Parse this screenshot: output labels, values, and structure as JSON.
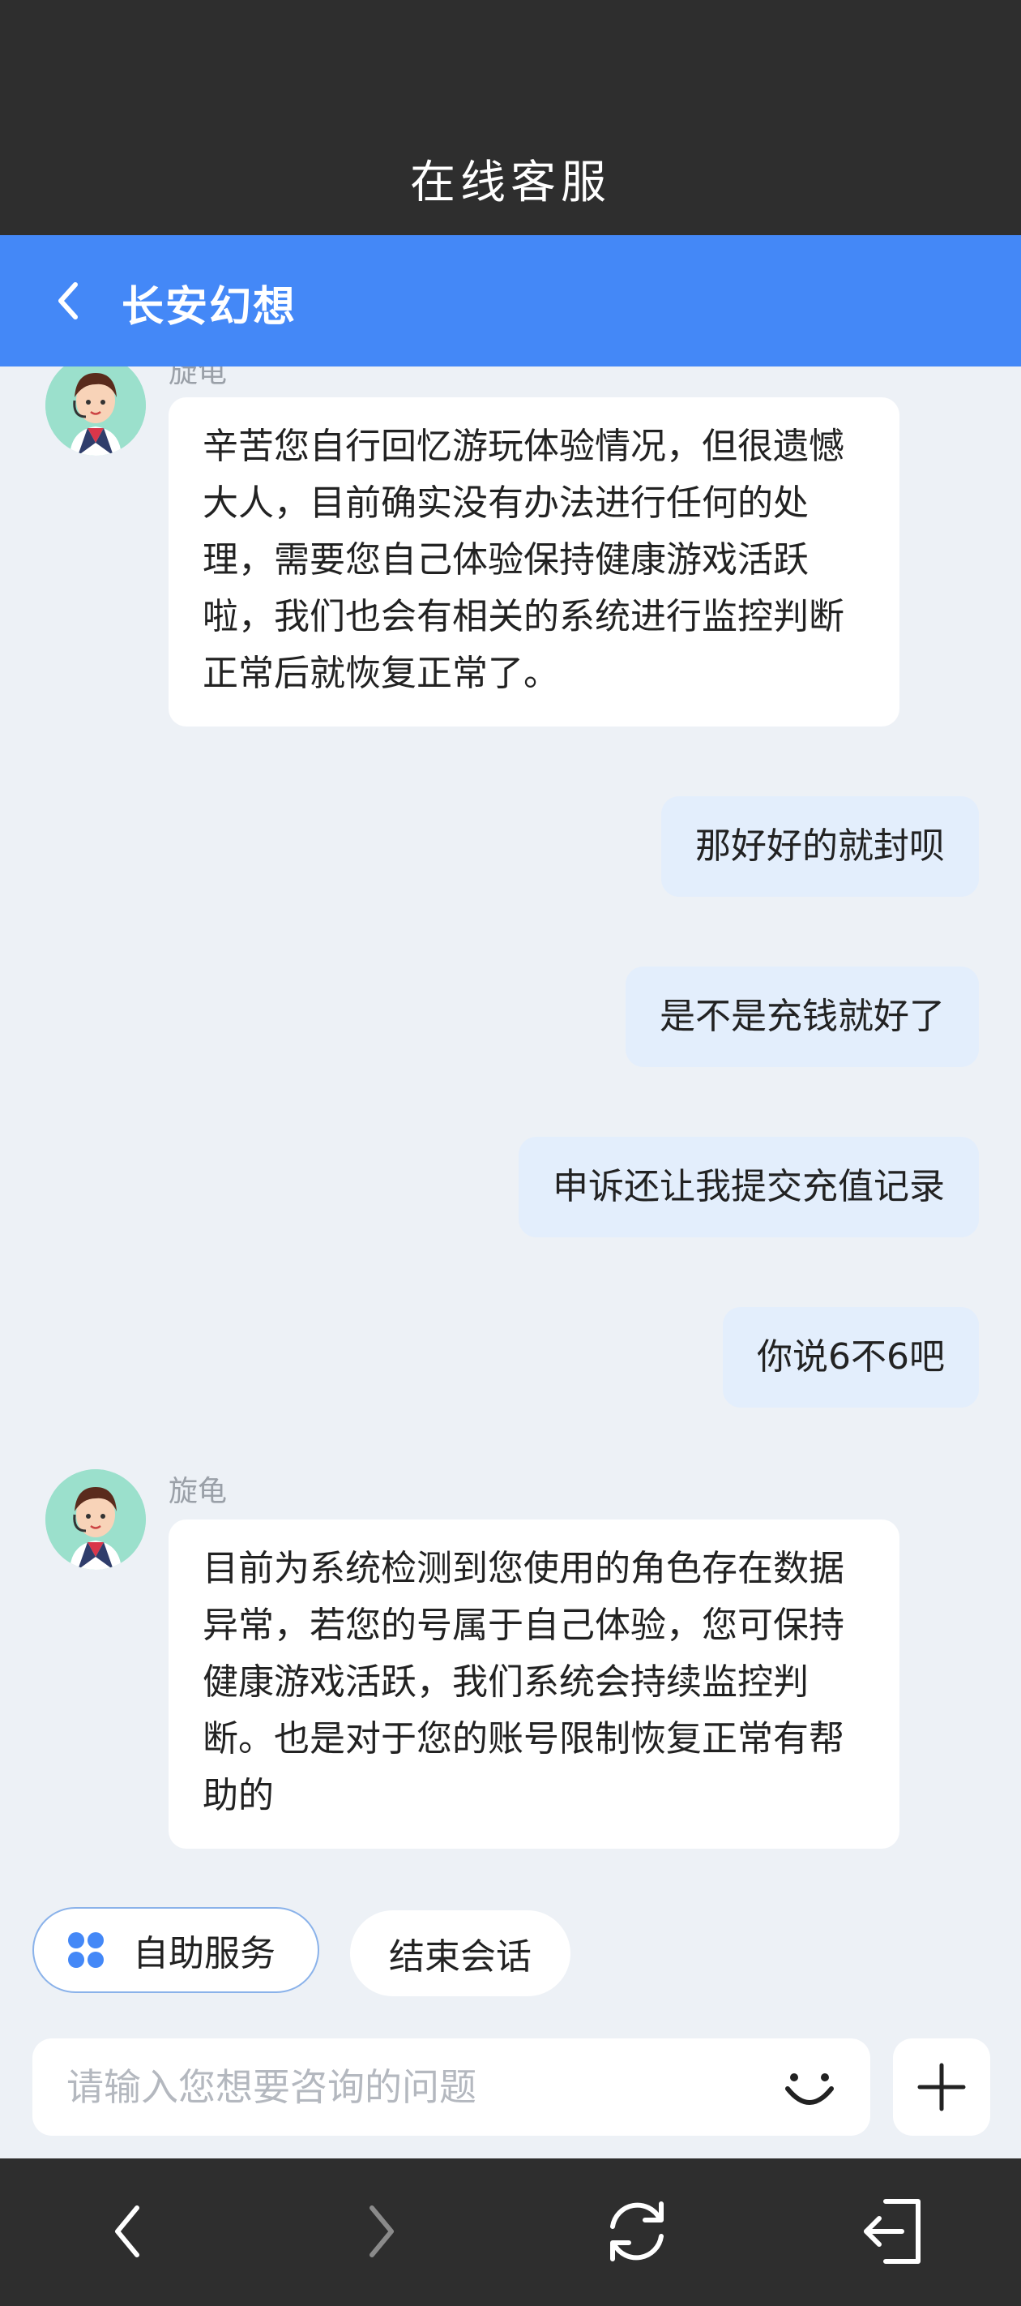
{
  "topbar": {
    "title": "在线客服"
  },
  "header": {
    "title": "长安幻想"
  },
  "messages": [
    {
      "from": "agent",
      "sender": "旋龟",
      "text": "辛苦您自行回忆游玩体验情况，但很遗憾大人，目前确实没有办法进行任何的处理，需要您自己体验保持健康游戏活跃啦，我们也会有相关的系统进行监控判断正常后就恢复正常了。"
    },
    {
      "from": "user",
      "text": "那好好的就封呗"
    },
    {
      "from": "user",
      "text": "是不是充钱就好了"
    },
    {
      "from": "user",
      "text": "申诉还让我提交充值记录"
    },
    {
      "from": "user",
      "text": "你说6不6吧"
    },
    {
      "from": "agent",
      "sender": "旋龟",
      "text": "目前为系统检测到您使用的角色存在数据异常，若您的号属于自己体验，您可保持健康游戏活跃，我们系统会持续监控判断。也是对于您的账号限制恢复正常有帮助的"
    }
  ],
  "quick_actions": {
    "self_service": "自助服务",
    "end_session": "结束会话"
  },
  "input": {
    "placeholder": "请输入您想要咨询的问题",
    "value": ""
  },
  "icons": {
    "back": "chevron-left-icon",
    "self_service": "grid-icon",
    "emoji": "smile-icon",
    "add": "plus-icon",
    "nav_back": "arrow-left-icon",
    "nav_forward": "arrow-right-icon",
    "nav_refresh": "refresh-icon",
    "nav_exit": "exit-icon"
  },
  "colors": {
    "brand_blue": "#4488f7",
    "dark_bar": "#2e2e2e",
    "background": "#edf1f6",
    "user_bubble": "#e3eefc",
    "agent_bubble": "#ffffff"
  }
}
